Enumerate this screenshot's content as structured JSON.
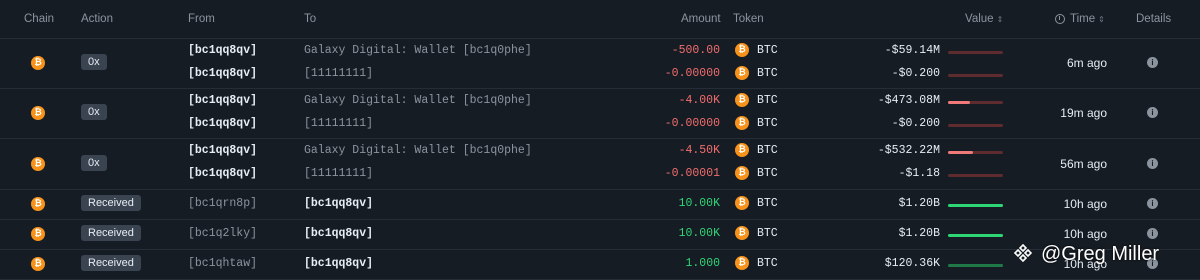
{
  "headers": {
    "chain": "Chain",
    "action": "Action",
    "from": "From",
    "to": "To",
    "amount": "Amount",
    "token": "Token",
    "value": "Value",
    "time": "Time",
    "details": "Details",
    "sort_glyph": "⇕"
  },
  "coin_glyph": "₿",
  "info_glyph": "i",
  "token_symbol": "BTC",
  "colors": {
    "negative": "#f26d6d",
    "positive": "#2fd675",
    "bar_negative_track": "#5e2b2e",
    "bar_negative_fill": "#f07a7a",
    "bar_positive": "#2fd675",
    "bar_positive_dim": "#1f7a47",
    "btc": "#f7931a"
  },
  "rows": [
    {
      "action": "0x",
      "time": "6m ago",
      "subrows": [
        {
          "from": "[bc1qq8qv]",
          "to": "Galaxy Digital: Wallet [bc1q0phe]",
          "amount": "-500.00",
          "value": "-$59.14M",
          "bar_fill": 0
        },
        {
          "from": "[bc1qq8qv]",
          "to": "[11111111]",
          "amount": "-0.00000",
          "value": "-$0.200",
          "bar_fill": 0
        }
      ]
    },
    {
      "action": "0x",
      "time": "19m ago",
      "subrows": [
        {
          "from": "[bc1qq8qv]",
          "to": "Galaxy Digital: Wallet [bc1q0phe]",
          "amount": "-4.00K",
          "value": "-$473.08M",
          "bar_fill": 0.4
        },
        {
          "from": "[bc1qq8qv]",
          "to": "[11111111]",
          "amount": "-0.00000",
          "value": "-$0.200",
          "bar_fill": 0
        }
      ]
    },
    {
      "action": "0x",
      "time": "56m ago",
      "subrows": [
        {
          "from": "[bc1qq8qv]",
          "to": "Galaxy Digital: Wallet [bc1q0phe]",
          "amount": "-4.50K",
          "value": "-$532.22M",
          "bar_fill": 0.45
        },
        {
          "from": "[bc1qq8qv]",
          "to": "[11111111]",
          "amount": "-0.00001",
          "value": "-$1.18",
          "bar_fill": 0
        }
      ]
    },
    {
      "action": "Received",
      "time": "10h ago",
      "from": "[bc1qrn8p]",
      "to": "[bc1qq8qv]",
      "amount": "10.00K",
      "value": "$1.20B",
      "bar_fill": 1
    },
    {
      "action": "Received",
      "time": "10h ago",
      "from": "[bc1q2lky]",
      "to": "[bc1qq8qv]",
      "amount": "10.00K",
      "value": "$1.20B",
      "bar_fill": 1
    },
    {
      "action": "Received",
      "time": "10h ago",
      "from": "[bc1qhtaw]",
      "to": "[bc1qq8qv]",
      "amount": "1.000",
      "value": "$120.36K",
      "bar_fill": 1
    }
  ],
  "watermark": "@Greg Miller"
}
